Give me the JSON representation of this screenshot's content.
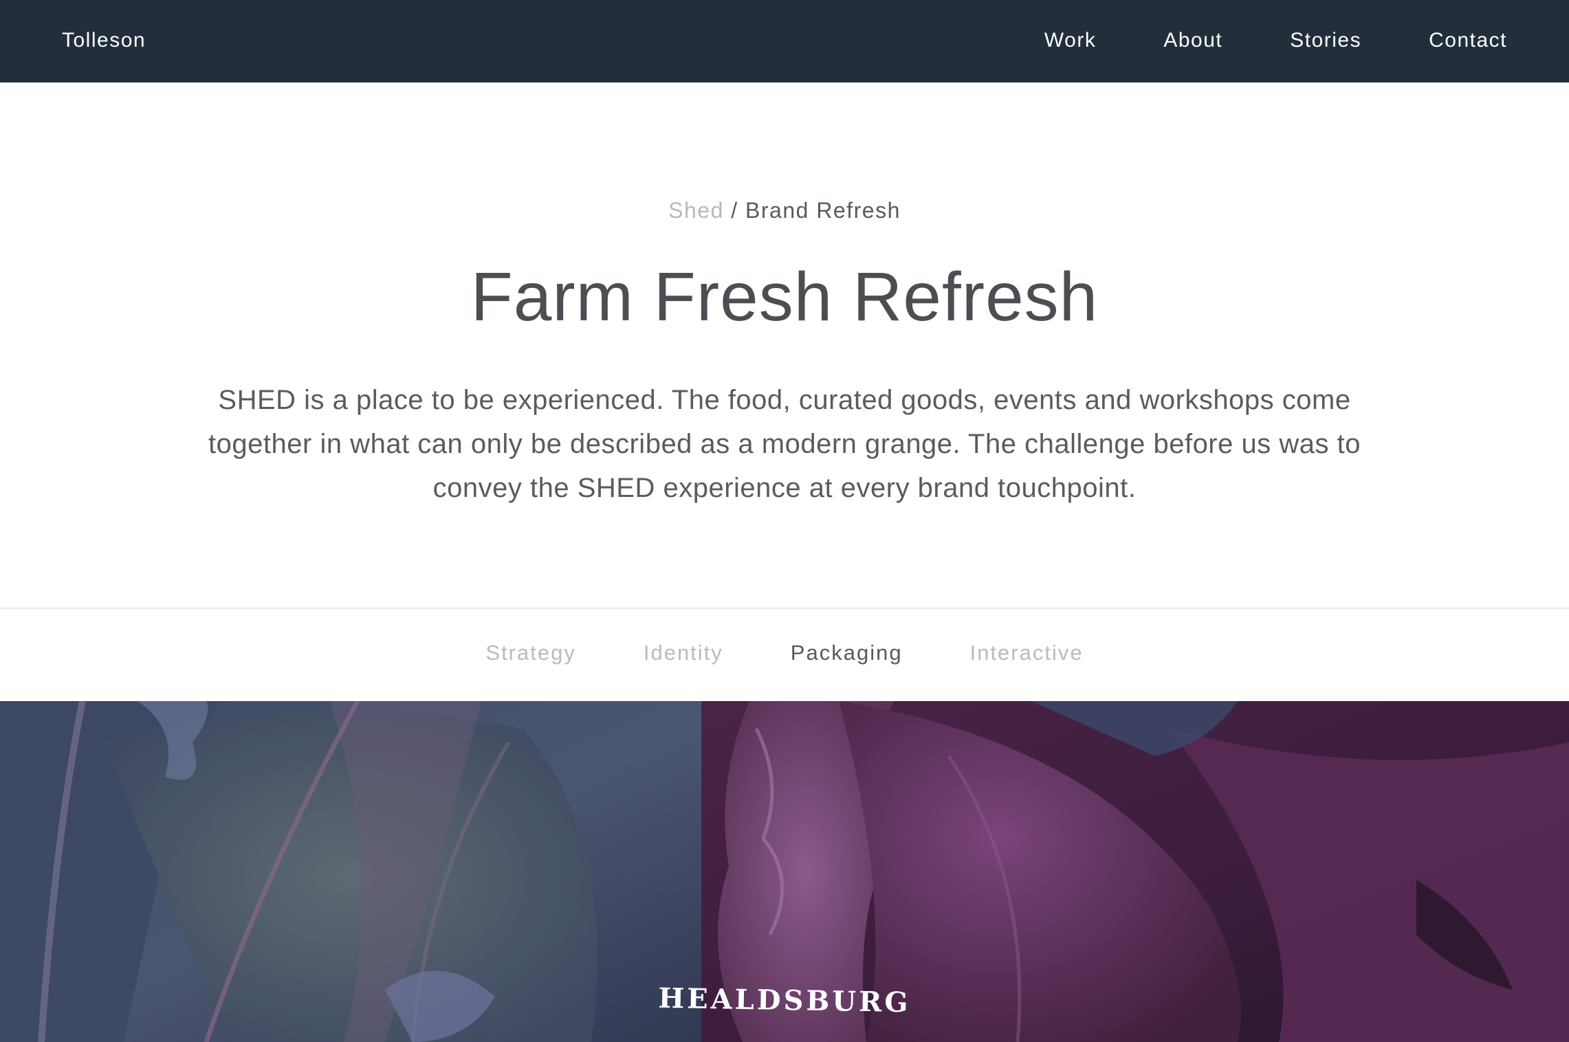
{
  "nav": {
    "brand": "Tolleson",
    "links": [
      "Work",
      "About",
      "Stories",
      "Contact"
    ]
  },
  "breadcrumb": {
    "parent": "Shed",
    "separator": "/",
    "current": "Brand Refresh"
  },
  "page_title": "Farm Fresh Refresh",
  "intro": "SHED is a place to be experienced. The food, curated goods, events and workshops come together in what can only be described as a modern grange. The challenge before us was to convey the SHED experience at every brand touchpoint.",
  "tabs": {
    "items": [
      "Strategy",
      "Identity",
      "Packaging",
      "Interactive"
    ],
    "active": "Packaging"
  },
  "hero": {
    "caption": "HEALDSBURG"
  },
  "colors": {
    "navbar": "#222f3b",
    "title_text": "#4b4e52",
    "muted_text": "#b5b9bc"
  }
}
